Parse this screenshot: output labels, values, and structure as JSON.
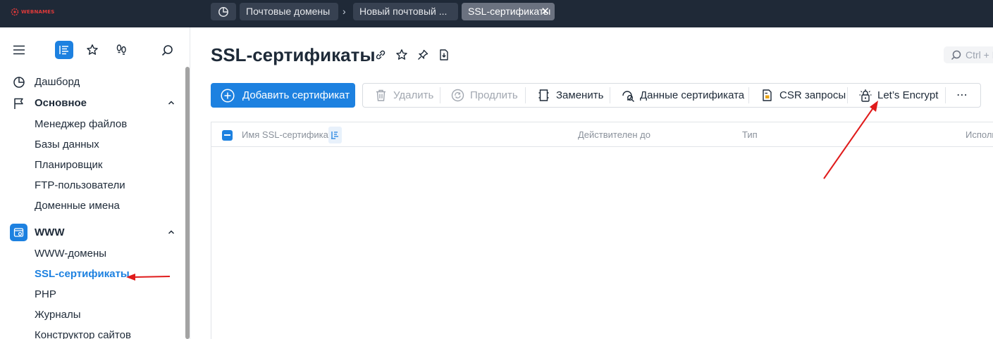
{
  "brand": {
    "logo_text": "WEBNAMES",
    "accent": "#1d81e0",
    "topbar_bg": "#1f2937",
    "arrow_color": "#e01b1b"
  },
  "topbar": {
    "breadcrumbs": [
      {
        "label": "Почтовые домены"
      },
      {
        "label": "Новый почтовый ..."
      },
      {
        "label": "SSL-сертификаты",
        "active": true
      }
    ]
  },
  "sidebar": {
    "top_icons": [
      "menu-icon",
      "list-icon",
      "star-icon",
      "footprints-icon",
      "search-icon"
    ],
    "dashboard": "Дашборд",
    "group_main": "Основное",
    "main_items": [
      "Менеджер файлов",
      "Базы данных",
      "Планировщик",
      "FTP-пользователи",
      "Доменные имена"
    ],
    "group_www": "WWW",
    "www_items": [
      "WWW-домены",
      "SSL-сертификаты",
      "PHP",
      "Журналы",
      "Конструктор сайтов"
    ],
    "current": "SSL-сертификаты"
  },
  "page": {
    "title": "SSL-сертификаты",
    "search_placeholder": "Ctrl + K"
  },
  "toolbar": {
    "add_label": "Добавить сертификат",
    "delete_label": "Удалить",
    "renew_label": "Продлить",
    "replace_label": "Заменить",
    "cert_data_label": "Данные сертификата",
    "csr_label": "CSR запросы",
    "letsencrypt_label": "Let’s Encrypt",
    "more_label": "⋯"
  },
  "table": {
    "columns": [
      "Имя SSL-сертификата",
      "Действителен до",
      "Тип",
      "Использ"
    ],
    "rows": []
  }
}
